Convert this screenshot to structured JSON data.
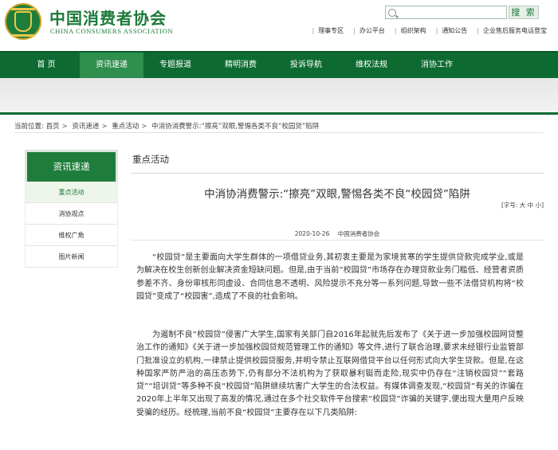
{
  "header": {
    "title": "中国消费者协会",
    "subtitle": "CHINA CONSUMERS ASSOCIATION",
    "search_button": "搜 索",
    "quick_links": [
      "理事专区",
      "办公平台",
      "组织架构",
      "通知公告",
      "企业售后服务电话登宝"
    ]
  },
  "nav": {
    "items": [
      "首 页",
      "资讯速递",
      "专题报道",
      "精明消费",
      "投诉导航",
      "维权法规",
      "消协工作"
    ]
  },
  "breadcrumb": {
    "label": "当前位置:",
    "items": [
      "首页",
      "资讯速递",
      "重点活动",
      "中消协消费警示:“擦亮”双眼,警惕各类不良“校园贷”陷阱"
    ]
  },
  "sidebar": {
    "title": "资讯速递",
    "items": [
      "重点活动",
      "消协观点",
      "维权广角",
      "图片新闻"
    ]
  },
  "section": {
    "title": "重点活动"
  },
  "article": {
    "title": "中消协消费警示:“擦亮”双眼,警惕各类不良“校园贷”陷阱",
    "font_size_label": "[字号:",
    "font_sizes": [
      "大",
      "中",
      "小"
    ],
    "font_size_end": "]",
    "date": "2020-10-26",
    "source": "中国消费者协会",
    "paragraphs": [
      "“校园贷”是主要面向大学生群体的一项借贷业务,其初衷主要是为家境贫寒的学生提供贷款完成学业,或是为解决在校生创新创业解决资金短缺问题。但是,由于当前“校园贷”市场存在办理贷款业务门槛低、经营者资质参差不齐、身份审核形同虚设、合同信息不透明、风险提示不充分等一系列问题,导致一些不法借贷机构将“校园贷”变成了“校园害”,造成了不良的社会影响。",
      "为遏制不良“校园贷”侵害广大学生,国家有关部门自2016年起就先后发布了《关于进一步加强校园网贷整治工作的通知》《关于进一步加强校园贷规范管理工作的通知》等文件,进行了联合治理,要求未经银行业监管部门批准设立的机构,一律禁止提供校园贷服务,并明令禁止互联网借贷平台以任何形式向大学生贷款。但是,在这种国家严防严治的高压态势下,仍有部分不法机构为了获取暴利铤而走险,现实中仍存在“注销校园贷”“套路贷”“培训贷”等多种不良“校园贷”陷阱继续坑害广大学生的合法权益。有媒体调查发现,“校园贷”有关的诈骗在2020年上半年又出现了高发的情况,通过在多个社交软件平台搜索“校园贷”诈骗的关键字,便出现大量用户反映受骗的经历。经梳理,当前不良“校园贷”主要存在以下几类陷阱:"
    ]
  }
}
